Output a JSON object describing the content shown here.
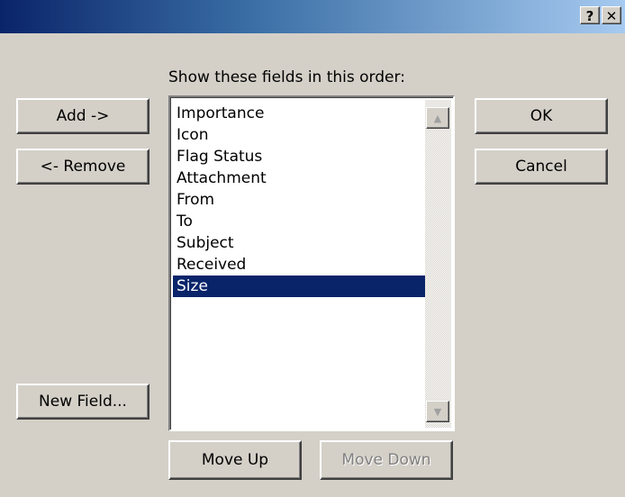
{
  "titlebar": {
    "help_label": "?",
    "close_label": "✕"
  },
  "fields_label": "Show these fields in this order:",
  "buttons": {
    "add": "Add ->",
    "remove": "<- Remove",
    "new_field": "New Field...",
    "ok": "OK",
    "cancel": "Cancel",
    "move_up": "Move Up",
    "move_down": "Move Down"
  },
  "fields": [
    "Importance",
    "Icon",
    "Flag Status",
    "Attachment",
    "From",
    "To",
    "Subject",
    "Received",
    "Size"
  ],
  "selected_field": "Size",
  "scroll_icons": {
    "up": "▲",
    "down": "▼"
  },
  "colors": {
    "face": "#d4d0c8",
    "selection": "#0a246a",
    "title_gradient_start": "#0a246a",
    "title_gradient_end": "#a6caf0"
  }
}
